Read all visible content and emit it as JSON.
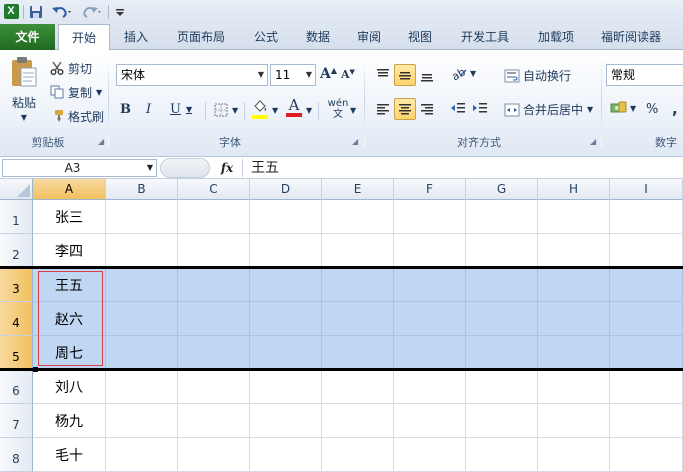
{
  "quick_access": {
    "icons": [
      "excel-logo-icon",
      "save-icon",
      "undo-icon",
      "redo-icon",
      "customize-qat-icon"
    ],
    "excel_logo_text": "X"
  },
  "tabs": [
    {
      "label": "文件",
      "name": "tab-file"
    },
    {
      "label": "开始",
      "name": "tab-home"
    },
    {
      "label": "插入",
      "name": "tab-insert"
    },
    {
      "label": "页面布局",
      "name": "tab-page-layout"
    },
    {
      "label": "公式",
      "name": "tab-formulas"
    },
    {
      "label": "数据",
      "name": "tab-data"
    },
    {
      "label": "审阅",
      "name": "tab-review"
    },
    {
      "label": "视图",
      "name": "tab-view"
    },
    {
      "label": "开发工具",
      "name": "tab-developer"
    },
    {
      "label": "加载项",
      "name": "tab-addins"
    },
    {
      "label": "福昕阅读器",
      "name": "tab-foxit"
    }
  ],
  "active_tab": "开始",
  "ribbon": {
    "clipboard": {
      "group_label": "剪贴板",
      "paste": "粘贴",
      "cut": "剪切",
      "copy": "复制",
      "format_painter": "格式刷"
    },
    "font": {
      "group_label": "字体",
      "font_name": "宋体",
      "font_size": "11",
      "grow_font": "A",
      "shrink_font": "A",
      "bold": "B",
      "italic": "I",
      "underline": "U",
      "font_color_letter": "A",
      "phonetic": "wén 文"
    },
    "alignment": {
      "group_label": "对齐方式",
      "wrap_text": "自动换行",
      "merge_center": "合并后居中"
    },
    "number": {
      "group_label": "数字",
      "format": "常规",
      "percent": "%",
      "comma": ","
    }
  },
  "formula_bar": {
    "name_box": "A3",
    "fx": "fx",
    "content": "王五"
  },
  "sheet": {
    "columns": [
      "A",
      "B",
      "C",
      "D",
      "E",
      "F",
      "G",
      "H",
      "I"
    ],
    "rows": [
      {
        "number": "1",
        "a": "张三"
      },
      {
        "number": "2",
        "a": "李四"
      },
      {
        "number": "3",
        "a": "王五"
      },
      {
        "number": "4",
        "a": "赵六"
      },
      {
        "number": "5",
        "a": "周七"
      },
      {
        "number": "6",
        "a": "刘八"
      },
      {
        "number": "7",
        "a": "杨九"
      },
      {
        "number": "8",
        "a": "毛十"
      }
    ],
    "selected_rows": [
      "3",
      "4",
      "5"
    ],
    "active_cell": "A3"
  },
  "colors": {
    "file_tab": "#2a7a2a",
    "selection_fill": "#bfd7f2",
    "selected_header": "#f5c96f",
    "font_color_bar": "#e02020",
    "highlight_bar": "#ffff00",
    "boundary_line": "#000000",
    "highlight_box": "#d94040"
  }
}
